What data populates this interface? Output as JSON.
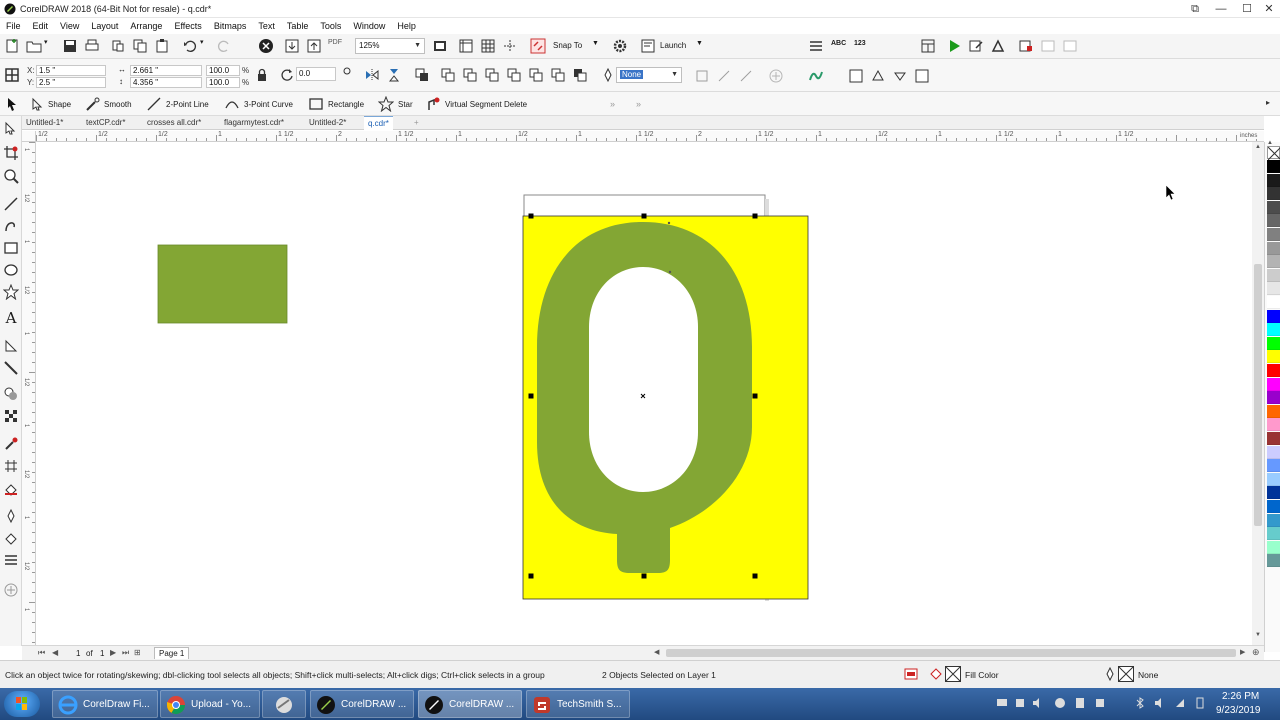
{
  "titlebar": {
    "title": "CorelDRAW 2018 (64-Bit Not for resale) - q.cdr*"
  },
  "menu": [
    "File",
    "Edit",
    "View",
    "Layout",
    "Arrange",
    "Effects",
    "Bitmaps",
    "Text",
    "Table",
    "Tools",
    "Window",
    "Help"
  ],
  "standard_toolbar": {
    "zoom": "125%",
    "snap_to": "Snap To",
    "launch": "Launch",
    "pdf": "PDF"
  },
  "property_bar": {
    "x_label": "X:",
    "x_value": "1.5 \"",
    "y_label": "Y:",
    "y_value": "2.5 \"",
    "w_value": "2.661 \"",
    "h_value": "4.356 \"",
    "scale_x": "100.0",
    "scale_y": "100.0",
    "percent": "%",
    "angle": "0.0",
    "outline": "None"
  },
  "tool_toolbar": {
    "items": [
      {
        "label": "Shape",
        "icon": "shape-tool-icon"
      },
      {
        "label": "Smooth",
        "icon": "smooth-tool-icon"
      },
      {
        "label": "2-Point Line",
        "icon": "two-point-line-icon"
      },
      {
        "label": "3-Point Curve",
        "icon": "three-point-curve-icon"
      },
      {
        "label": "Rectangle",
        "icon": "rectangle-tool-icon"
      },
      {
        "label": "Star",
        "icon": "star-tool-icon"
      },
      {
        "label": "Virtual Segment Delete",
        "icon": "virtual-segment-delete-icon"
      }
    ]
  },
  "doc_tabs": [
    "Untitled-1*",
    "textCP.cdr*",
    "crosses all.cdr*",
    "flagarmytest.cdr*",
    "Untitled-2*",
    "q.cdr*"
  ],
  "active_tab": "q.cdr*",
  "ruler": {
    "units": "inches",
    "h_labels": [
      "1/2",
      "1/2",
      "1/2",
      "1",
      "1 1/2",
      "2",
      "1 1/2",
      "1",
      "1/2",
      "1",
      "1 1/2",
      "2",
      "1 1/2",
      "1",
      "1/2",
      "1",
      "1 1/2",
      "1",
      "1 1/2"
    ],
    "v_labels": [
      "1",
      "1/2",
      "1",
      "1/2",
      "1",
      "1/2",
      "1",
      "1/2",
      "1",
      "1/2",
      "1"
    ]
  },
  "page_nav": {
    "current": "1",
    "of": "of",
    "total": "1",
    "page_tab": "Page 1"
  },
  "palette": [
    "#000000",
    "#1a1a1a",
    "#333333",
    "#4d4d4d",
    "#666666",
    "#808080",
    "#999999",
    "#b3b3b3",
    "#cccccc",
    "#e6e6e6",
    "#ffffff",
    "#0000ff",
    "#00ffff",
    "#00ff00",
    "#ffff00",
    "#ff0000",
    "#ff00ff",
    "#9900cc",
    "#ff6600",
    "#ff99cc",
    "#993333",
    "#ccccff",
    "#6699ff",
    "#99ccff",
    "#003399",
    "#0066cc",
    "#3399cc",
    "#66cccc",
    "#99ffcc",
    "#669999"
  ],
  "canvas": {
    "green_rect_color": "#83a634",
    "page_fill_color": "#ffff00",
    "glyph_color": "#83a634",
    "glyph_counter_color": "#ffffff"
  },
  "status": {
    "hint": "Click an object twice for rotating/skewing; dbl-clicking tool selects all objects; Shift+click multi-selects; Alt+click digs; Ctrl+click selects in a group",
    "selection": "2 Objects Selected on Layer 1",
    "fill": "Fill Color",
    "outline": "None"
  },
  "taskbar": {
    "tasks": [
      {
        "label": "CorelDraw Fi...",
        "icon": "internet-explorer-icon"
      },
      {
        "label": "Upload - Yo...",
        "icon": "chrome-icon"
      },
      {
        "label": "",
        "icon": "app-icon"
      },
      {
        "label": "CorelDRAW ...",
        "icon": "coreldraw-icon"
      },
      {
        "label": "CorelDRAW ...",
        "icon": "coreldraw-icon"
      },
      {
        "label": "TechSmith S...",
        "icon": "techsmith-icon"
      }
    ],
    "time": "2:26 PM",
    "date": "9/23/2019"
  }
}
